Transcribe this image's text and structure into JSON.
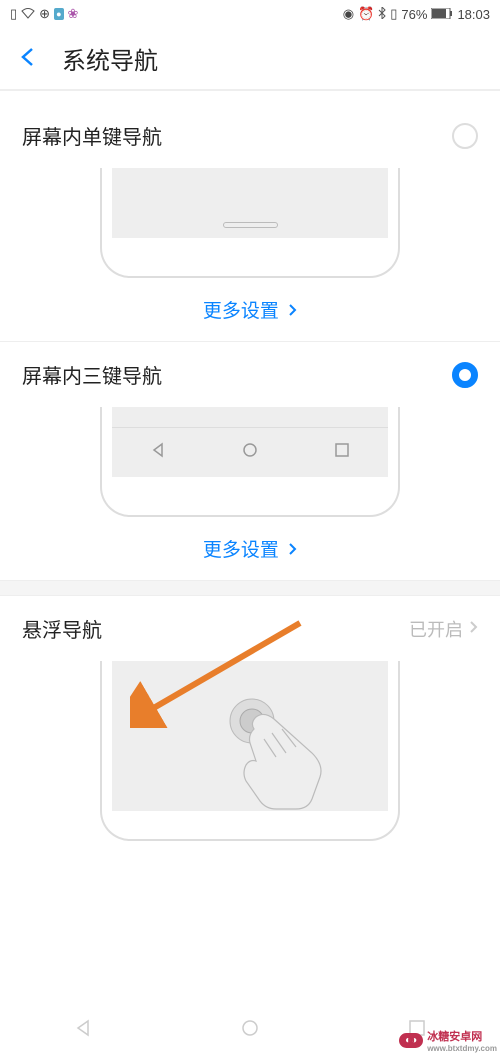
{
  "statusBar": {
    "battery": "76%",
    "time": "18:03"
  },
  "header": {
    "title": "系统导航"
  },
  "options": {
    "single": {
      "label": "屏幕内单键导航",
      "moreSettings": "更多设置"
    },
    "three": {
      "label": "屏幕内三键导航",
      "moreSettings": "更多设置"
    },
    "floating": {
      "label": "悬浮导航",
      "status": "已开启"
    }
  },
  "watermark": {
    "text": "冰糖安卓网",
    "url": "www.btxtdmy.com"
  }
}
